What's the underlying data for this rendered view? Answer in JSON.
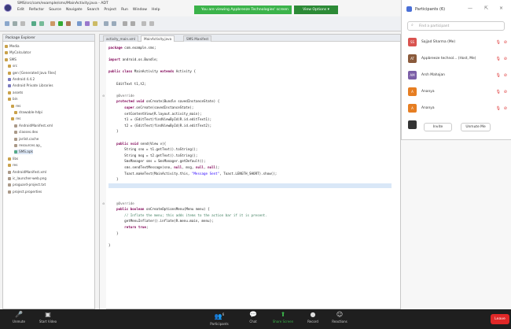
{
  "window": {
    "title": "SMS/src/com/example/sms/MainActivity.java - ADT",
    "menu": [
      "Edit",
      "Refactor",
      "Source",
      "Navigate",
      "Search",
      "Project",
      "Run",
      "Window",
      "Help"
    ]
  },
  "share_banner": {
    "text": "You are viewing Appbreeze Technologies' screen",
    "view_options": "View Options ▾"
  },
  "package_explorer": {
    "title": "Package Explorer",
    "items": [
      "Media",
      "MyCalculator",
      "SMS",
      "src",
      "gen [Generated Java Files]",
      "Android 4.4.2",
      "Android Private Libraries",
      "assets",
      "bin",
      "res",
      "drawable-hdpi",
      "res",
      "AndroidManifest.xml",
      "classes.dex",
      "jarlist.cache",
      "resources.ap_",
      "SMS.apk",
      "libs",
      "res",
      "AndroidManifest.xml",
      "ic_launcher-web.png",
      "proguard-project.txt",
      "project.properties"
    ]
  },
  "editor": {
    "tabs": [
      "activity_main.xml",
      "MainActivity.java",
      "SMS Manifest"
    ],
    "code": [
      "package com.example.sms;",
      "",
      "import android.os.Bundle;",
      "",
      "public class MainActivity extends Activity {",
      "",
      "    EditText t1,t2;",
      "",
      "    @Override",
      "    protected void onCreate(Bundle savedInstanceState) {",
      "        super.onCreate(savedInstanceState);",
      "        setContentView(R.layout.activity_main);",
      "        t1 = (EditText)findViewById(R.id.editText1);",
      "        t2 = (EditText)findViewById(R.id.editText2);",
      "    }",
      "",
      "    public void send(View v){",
      "        String sno = t1.getText().toString();",
      "        String msg = t2.getText().toString();",
      "        SmsManager sms = SmsManager.getDefault();",
      "        sms.sendTextMessage(sno, null, msg, null, null);",
      "        Toast.makeText(MainActivity.this, \"Message Sent\", Toast.LENGTH_SHORT).show();",
      "    }",
      "",
      "",
      "",
      "    @Override",
      "    public boolean onCreateOptionsMenu(Menu menu) {",
      "        // Inflate the menu; this adds items to the action bar if it is present.",
      "        getMenuInflater().inflate(R.menu.main, menu);",
      "        return true;",
      "    }",
      "",
      "}"
    ]
  },
  "participants": {
    "title": "Participants (6)",
    "search_placeholder": "Find a participant",
    "list": [
      {
        "initials": "SS",
        "name": "Sajjad Sharma (Me)",
        "color": "#d9534f"
      },
      {
        "initials": "AT",
        "name": "Appbreeze technol... (Host, Me)",
        "color": "#8a5a3b"
      },
      {
        "initials": "AM",
        "name": "Arsh Mahajan",
        "color": "#7b5ea7"
      },
      {
        "initials": "A",
        "name": "Ananya",
        "color": "#e67e22"
      },
      {
        "initials": "A",
        "name": "Ananya",
        "color": "#e67e22"
      },
      {
        "initials": "",
        "name": "",
        "color": "#333333"
      }
    ],
    "invite": "Invite",
    "unmute": "Unmute Me"
  },
  "zoombar": {
    "left": [
      {
        "icon": "🎤",
        "label": "Unmute"
      },
      {
        "icon": "▣",
        "label": "Start Video"
      }
    ],
    "center": [
      {
        "icon": "👥",
        "label": "Participants"
      },
      {
        "icon": "💬",
        "label": "Chat"
      },
      {
        "icon": "⬆",
        "label": "Share Screen"
      },
      {
        "icon": "●",
        "label": "Record"
      },
      {
        "icon": "☺",
        "label": "Reactions"
      }
    ],
    "leave": "Leave",
    "participant_count": "6"
  },
  "colors": {
    "share_green": "#3bb34a",
    "leave_red": "#e02828",
    "zoombar_bg": "#1f1f1f"
  }
}
